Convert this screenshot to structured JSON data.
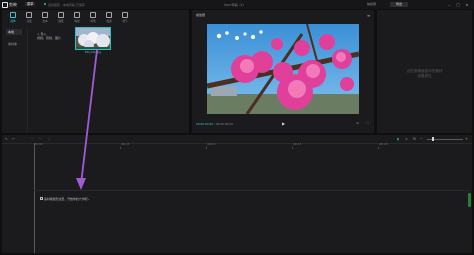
{
  "app": {
    "name": "剪映",
    "menu_label": "菜单",
    "autosave_text": "自动保存 · 本地草稿 已保存",
    "doc_title": "0527草稿（1）",
    "shortcut_label": "快捷键",
    "export_label": "导出"
  },
  "toolbar": {
    "items": [
      {
        "label": "媒体",
        "icon": "media-icon"
      },
      {
        "label": "音频",
        "icon": "audio-icon"
      },
      {
        "label": "文本",
        "icon": "text-icon"
      },
      {
        "label": "贴纸",
        "icon": "sticker-icon"
      },
      {
        "label": "特效",
        "icon": "effects-icon"
      },
      {
        "label": "转场",
        "icon": "transition-icon"
      },
      {
        "label": "滤镜",
        "icon": "filter-icon"
      },
      {
        "label": "调节",
        "icon": "adjust-icon"
      }
    ]
  },
  "sidebar": {
    "items": [
      "本地",
      "素材库"
    ]
  },
  "media": {
    "import_label": "+ 导入",
    "import_hint": "视频、音频、图片",
    "thumb_caption": "IMG_0401.jpg"
  },
  "player": {
    "title": "播放器",
    "current_time": "00:00:00:00",
    "total_time": "00:00:00:00",
    "menu_glyph": "≡"
  },
  "properties": {
    "empty_line1": "点击剪辑面板中的素材",
    "empty_line2": "查看属性"
  },
  "timeline": {
    "ruler": [
      "00:00",
      "|00:05",
      "|00:10",
      "|00:15",
      "|00:20"
    ],
    "drop_hint": "素材拖拽到这里，开始你的大作吧~"
  },
  "colors": {
    "accent": "#3ec6d8",
    "arrow": "#a05cd6",
    "scroll": "#2a7d33"
  }
}
